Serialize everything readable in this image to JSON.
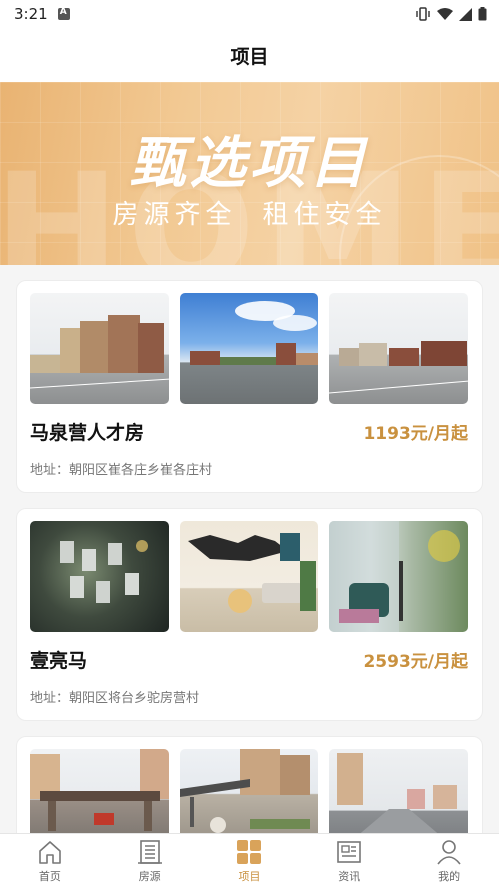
{
  "status_bar": {
    "time": "3:21"
  },
  "header": {
    "title": "项目"
  },
  "banner": {
    "title": "甄选项目",
    "subtitle_left": "房源齐全",
    "subtitle_right": "租住安全",
    "watermark": "HOME"
  },
  "projects": [
    {
      "name": "马泉营人才房",
      "price": "1193元/月起",
      "address": "地址：朝阳区崔各庄乡崔各庄村"
    },
    {
      "name": "壹亮马",
      "price": "2593元/月起",
      "address": "地址：朝阳区将台乡驼房营村"
    },
    {
      "name": "",
      "price": "",
      "address": ""
    }
  ],
  "tabbar": [
    {
      "label": "首页",
      "icon": "home-icon"
    },
    {
      "label": "房源",
      "icon": "building-icon"
    },
    {
      "label": "项目",
      "icon": "grid-icon"
    },
    {
      "label": "资讯",
      "icon": "news-icon"
    },
    {
      "label": "我的",
      "icon": "person-icon"
    }
  ],
  "colors": {
    "accent": "#c9913f",
    "banner": "#f2c993"
  }
}
